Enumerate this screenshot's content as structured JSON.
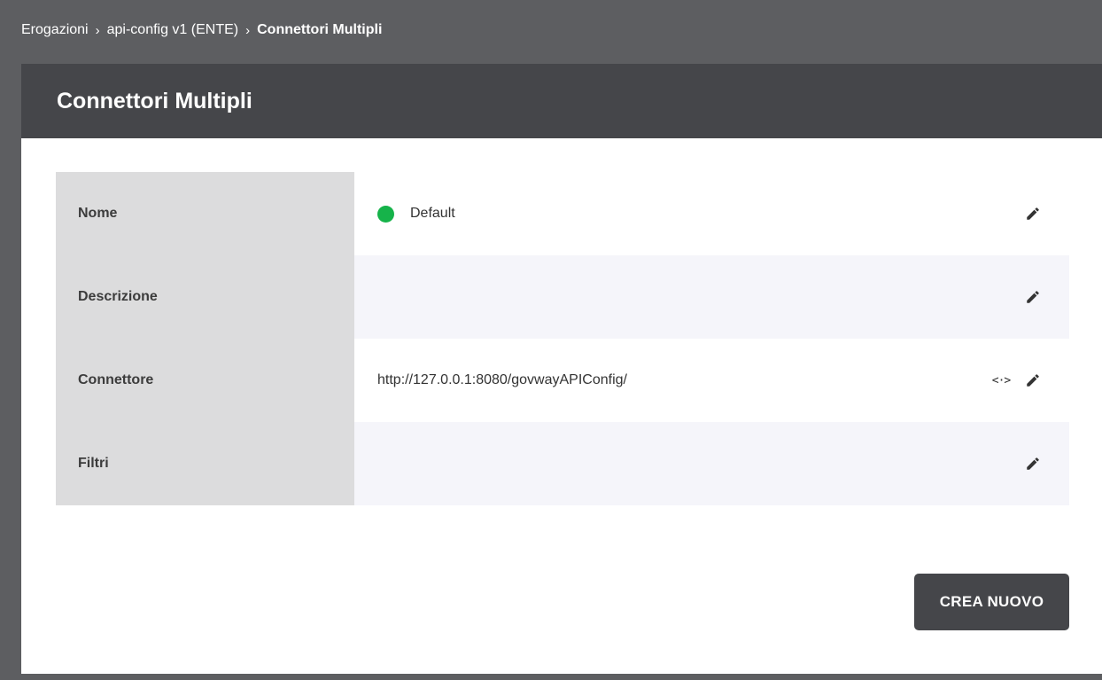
{
  "breadcrumb": {
    "items": [
      "Erogazioni",
      "api-config v1 (ENTE)"
    ],
    "current": "Connettori Multipli",
    "separator": "›"
  },
  "page": {
    "title": "Connettori Multipli"
  },
  "details": {
    "rows": [
      {
        "label": "Nome",
        "value": "Default",
        "status": "active"
      },
      {
        "label": "Descrizione",
        "value": ""
      },
      {
        "label": "Connettore",
        "value": "http://127.0.0.1:8080/govwayAPIConfig/",
        "code_icon": "<·>"
      },
      {
        "label": "Filtri",
        "value": ""
      }
    ],
    "edit_icon": "pencil-icon"
  },
  "actions": {
    "create_label": "CREA NUOVO"
  },
  "colors": {
    "header_bg": "#45464a",
    "outer_bg": "#5d5e61",
    "label_bg": "#dcdcdd",
    "alt_row_bg": "#f5f5fa",
    "status_active": "#16b34a"
  }
}
